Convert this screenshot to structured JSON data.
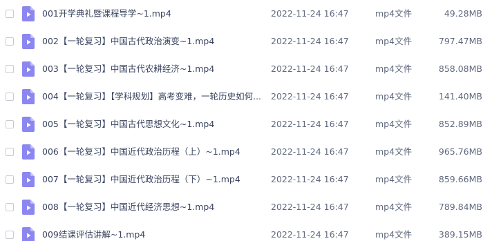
{
  "files": [
    {
      "name": "001开学典礼暨课程导学~1.mp4",
      "date": "2022-11-24 16:47",
      "type": "mp4文件",
      "size": "49.28MB",
      "icon": "video-file-icon"
    },
    {
      "name": "002【一轮复习】中国古代政治演变~1.mp4",
      "date": "2022-11-24 16:47",
      "type": "mp4文件",
      "size": "797.47MB",
      "icon": "video-file-icon"
    },
    {
      "name": "003【一轮复习】中国古代农耕经济~1.mp4",
      "date": "2022-11-24 16:47",
      "type": "mp4文件",
      "size": "858.08MB",
      "icon": "video-file-icon"
    },
    {
      "name": "004【一轮复习】【学科规划】高考变难，一轮历史如何...",
      "date": "2022-11-24 16:47",
      "type": "mp4文件",
      "size": "141.40MB",
      "icon": "video-file-icon"
    },
    {
      "name": "005【一轮复习】中国古代思想文化~1.mp4",
      "date": "2022-11-24 16:47",
      "type": "mp4文件",
      "size": "852.89MB",
      "icon": "video-file-icon"
    },
    {
      "name": "006【一轮复习】中国近代政治历程（上）~1.mp4",
      "date": "2022-11-24 16:47",
      "type": "mp4文件",
      "size": "965.76MB",
      "icon": "video-file-icon"
    },
    {
      "name": "007【一轮复习】中国近代政治历程（下）~1.mp4",
      "date": "2022-11-24 16:47",
      "type": "mp4文件",
      "size": "859.66MB",
      "icon": "video-file-icon"
    },
    {
      "name": "008【一轮复习】中国近代经济思想~1.mp4",
      "date": "2022-11-24 16:47",
      "type": "mp4文件",
      "size": "789.84MB",
      "icon": "video-file-icon"
    },
    {
      "name": "009结课评估讲解~1.mp4",
      "date": "2022-11-24 16:47",
      "type": "mp4文件",
      "size": "389.15MB",
      "icon": "video-file-icon"
    }
  ],
  "colors": {
    "icon_body": "#8b86f0",
    "icon_fold": "#c3c0f8",
    "checkbox_border": "#c7cbd3",
    "text_primary": "#3b4560",
    "text_secondary": "#606a7e"
  }
}
